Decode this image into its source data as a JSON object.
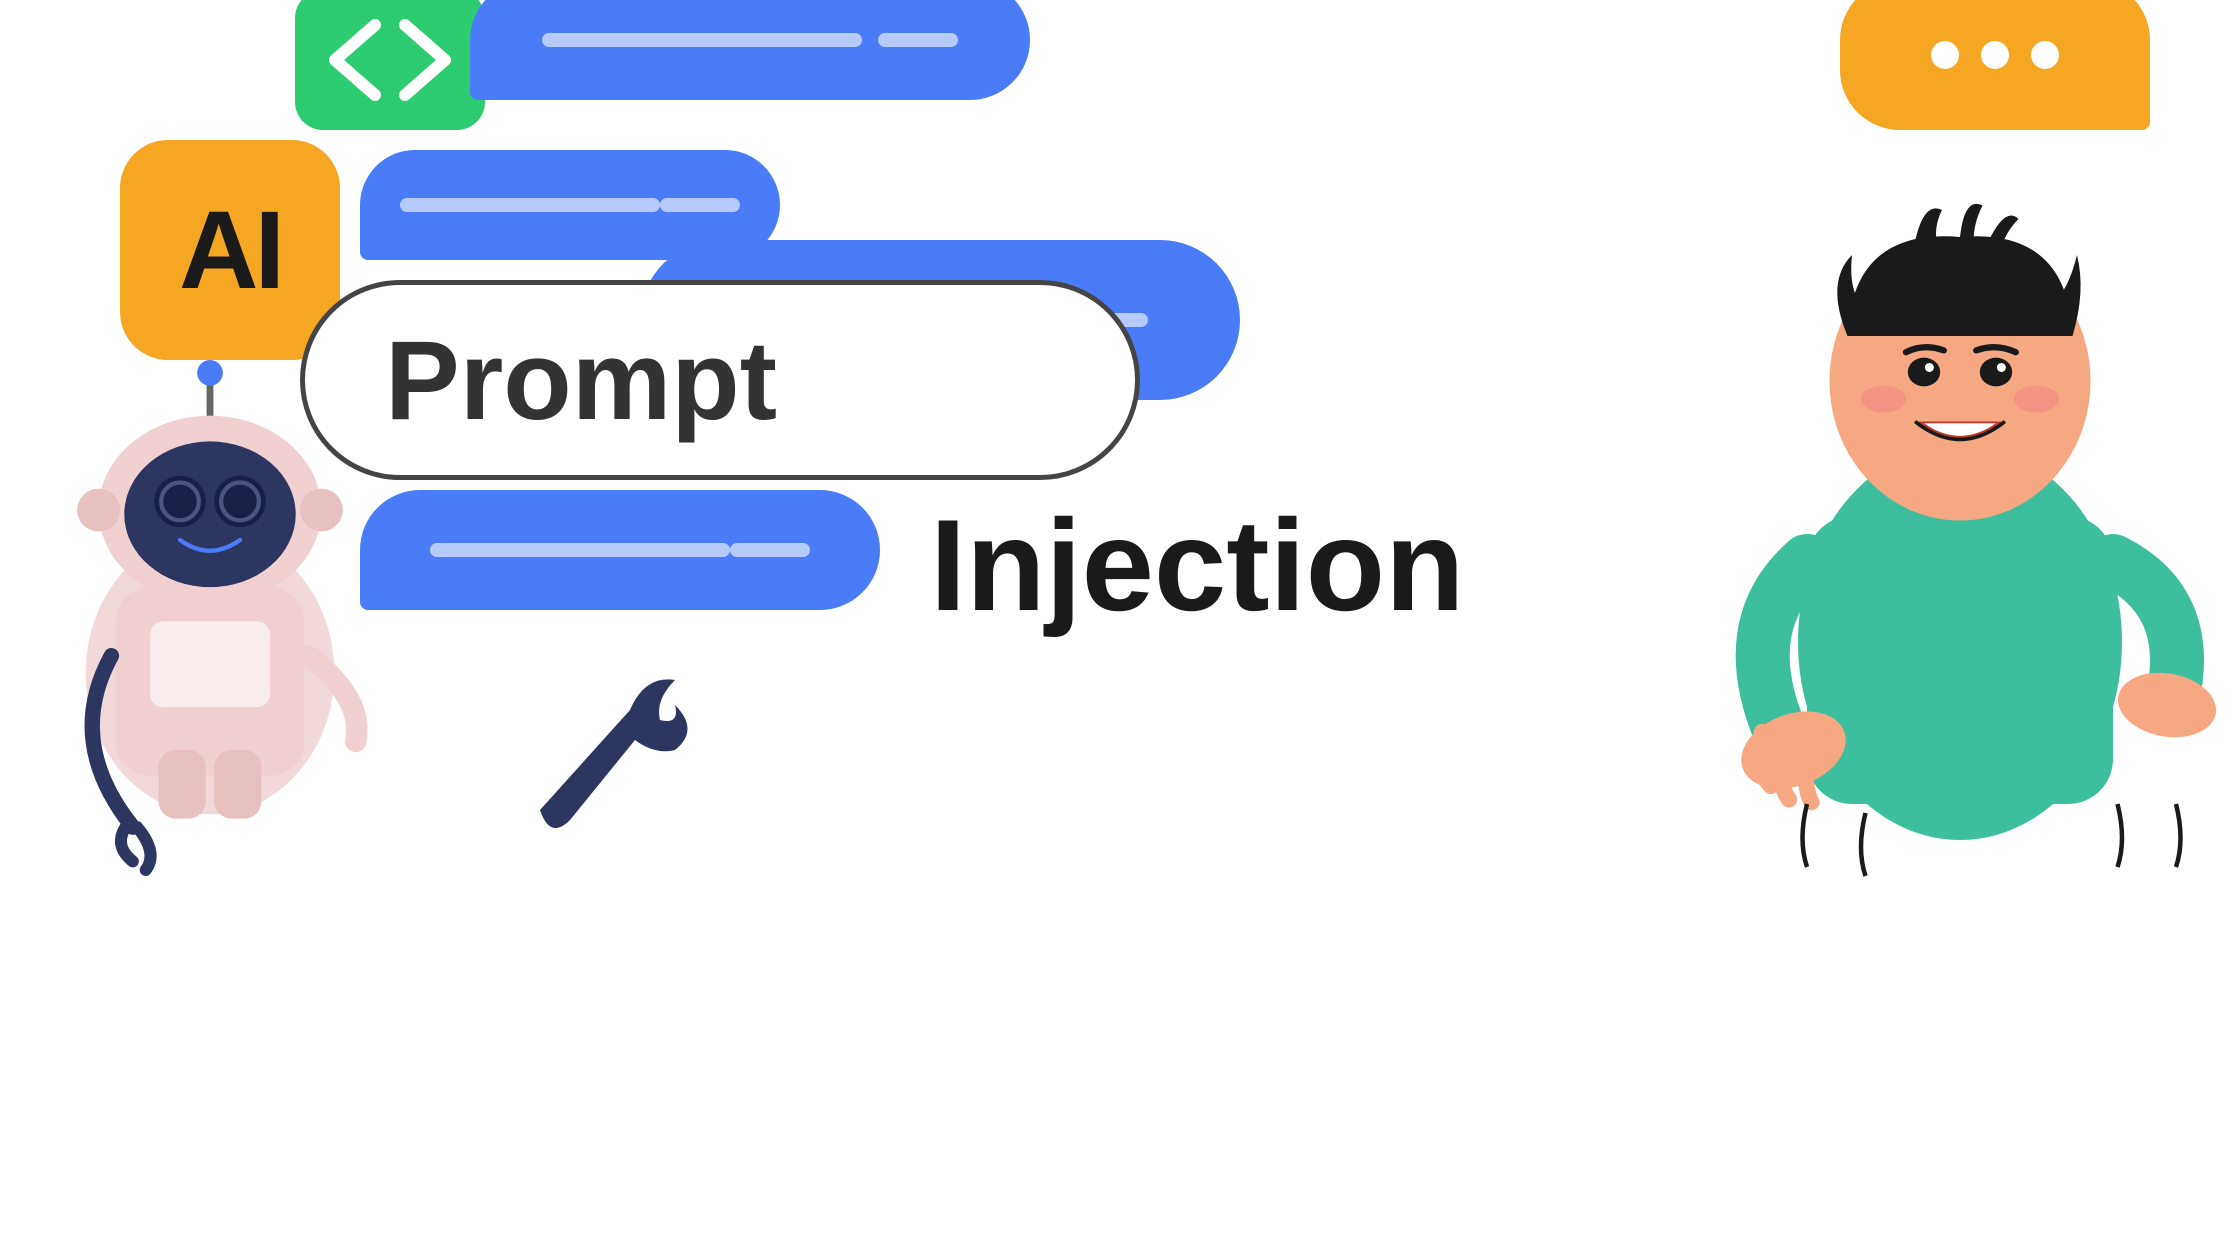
{
  "scene": {
    "background_color": "#ffffff",
    "title": "Prompt Injection"
  },
  "ai_badge": {
    "text": "AI",
    "bg_color": "#F5A623",
    "text_color": "#1a1a1a"
  },
  "code_icon": {
    "symbol": "</>",
    "bg_color": "#2ECC71",
    "symbol_color": "#ffffff"
  },
  "chat_bubbles": [
    {
      "id": "top_large",
      "color": "#4A7CF7",
      "position": "top-center"
    },
    {
      "id": "top_right",
      "color": "#F5A623",
      "position": "top-right"
    },
    {
      "id": "mid_left",
      "color": "#4A7CF7",
      "position": "mid-left"
    },
    {
      "id": "prompt_right",
      "color": "#4A7CF7",
      "position": "prompt-right"
    },
    {
      "id": "bottom",
      "color": "#4A7CF7",
      "position": "bottom-left"
    }
  ],
  "prompt_box": {
    "label": "Prompt",
    "border_color": "#444444",
    "background": "#ffffff"
  },
  "injection_label": "Injection",
  "characters": {
    "robot": "friendly pink robot with dark blue face",
    "human": "smiling person with teal shirt gesturing"
  }
}
